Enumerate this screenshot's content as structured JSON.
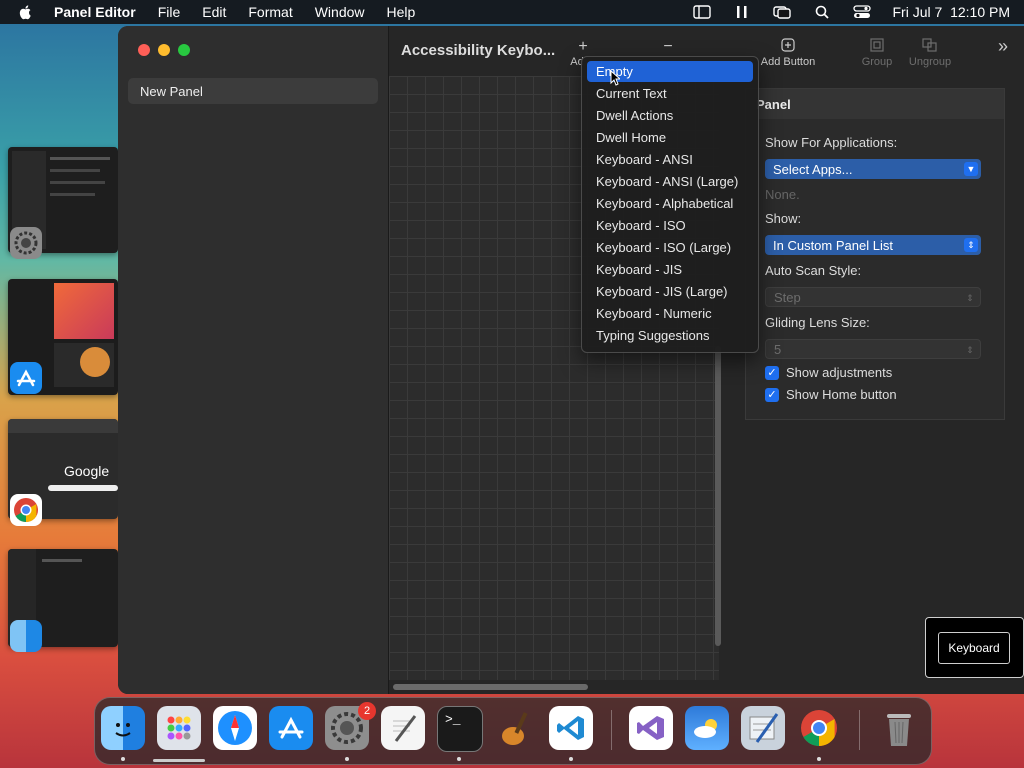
{
  "menubar": {
    "app_name": "Panel Editor",
    "items": [
      "File",
      "Edit",
      "Format",
      "Window",
      "Help"
    ],
    "clock": "Fri Jul 7  12:10 PM"
  },
  "window": {
    "title": "Accessibility Keybo...",
    "sidebar_items": [
      "New Panel"
    ],
    "toolbar": {
      "add_label": "Ad",
      "add_button_label": "Add Button",
      "group_label": "Group",
      "ungroup_label": "Ungroup"
    }
  },
  "dropdown": {
    "items": [
      "Empty",
      "Current Text",
      "Dwell Actions",
      "Dwell Home",
      "Keyboard - ANSI",
      "Keyboard - ANSI (Large)",
      "Keyboard - Alphabetical",
      "Keyboard - ISO",
      "Keyboard - ISO (Large)",
      "Keyboard - JIS",
      "Keyboard - JIS (Large)",
      "Keyboard - Numeric",
      "Typing Suggestions"
    ],
    "highlighted": "Empty"
  },
  "inspector": {
    "header": "Panel",
    "show_for_apps_label": "Show For Applications:",
    "select_apps_value": "Select Apps...",
    "none_text": "None.",
    "show_label": "Show:",
    "show_value": "In Custom Panel List",
    "auto_scan_label": "Auto Scan Style:",
    "auto_scan_value": "Step",
    "gliding_lens_label": "Gliding Lens Size:",
    "gliding_lens_value": "5",
    "show_adjustments_label": "Show adjustments",
    "show_adjustments_checked": true,
    "show_home_label": "Show Home button",
    "show_home_checked": true
  },
  "keyboard_widget": {
    "label": "Keyboard"
  },
  "thumbnails": {
    "google_text": "Google"
  },
  "dock": {
    "icons": [
      "finder-icon",
      "launchpad-icon",
      "safari-icon",
      "app-store-icon",
      "system-settings-icon",
      "textedit-icon",
      "terminal-icon",
      "garageband-icon",
      "vscode-icon",
      "visual-studio-icon",
      "weather-icon",
      "editor-icon",
      "chrome-icon",
      "trash-icon"
    ],
    "settings_badge": "2"
  }
}
